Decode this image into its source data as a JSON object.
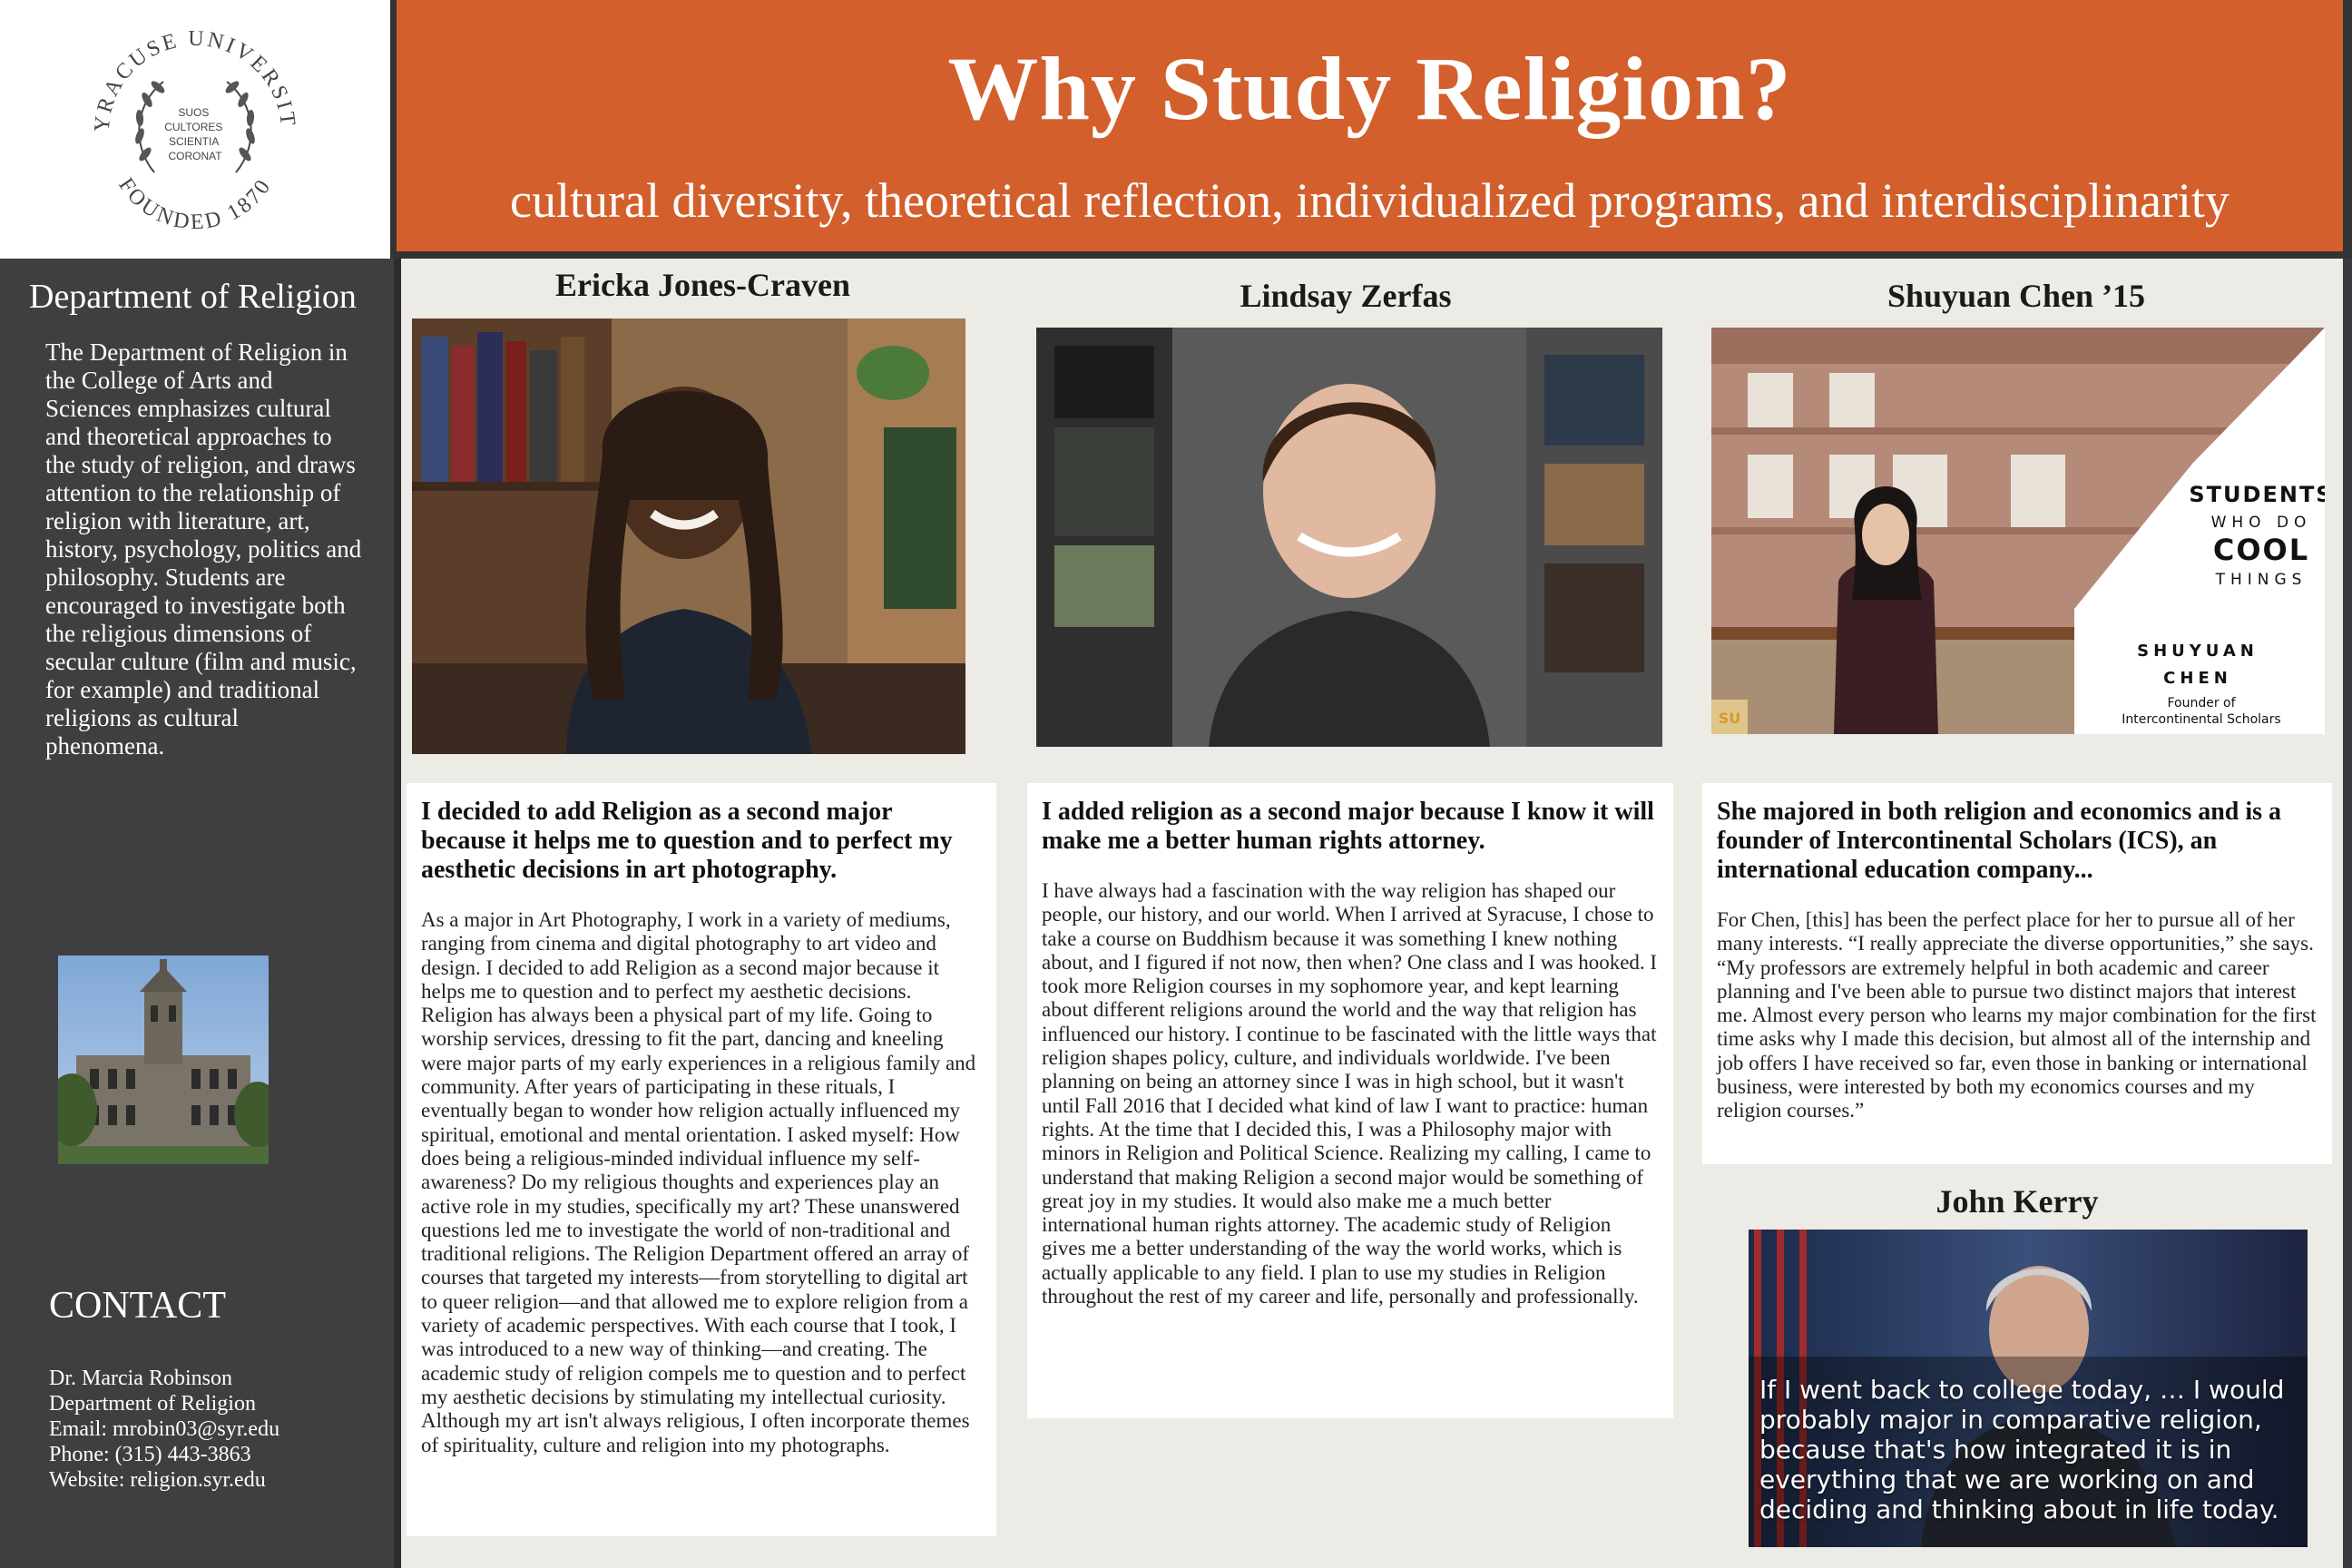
{
  "logo": {
    "ring_text": "SYRACUSE UNIVERSITY",
    "founded_text": "FOUNDED 1870",
    "motto_lines": [
      "SUOS",
      "CULTORES",
      "SCIENTIA",
      "CORONAT"
    ]
  },
  "header": {
    "title": "Why Study Religion?",
    "subtitle": "cultural diversity, theoretical reflection, individualized programs, and interdisciplinarity"
  },
  "sidebar": {
    "heading": "Department of Religion",
    "description": "The Department of Religion in the College of Arts and Sciences emphasizes cultural and theoretical approaches to the study of religion, and draws attention to the relationship of religion with literature, art, history, psychology, politics and philosophy. Students are encouraged to investigate both the religious dimensions of secular culture (film and music, for example) and traditional religions as cultural phenomena.",
    "contact_heading": "CONTACT",
    "contact_lines": [
      "Dr. Marcia Robinson",
      "Department of Religion",
      "Email: mrobin03@syr.edu",
      "Phone: (315) 443-3863",
      "Website: religion.syr.edu"
    ]
  },
  "profiles": [
    {
      "name": "Ericka Jones-Craven",
      "lead": "I decided to add Religion as a second major because it helps me to question and to perfect my aesthetic decisions in art photography.",
      "body": "As a major in Art Photography, I work in a variety of mediums, ranging from cinema and digital photography to art video and design. I decided to add Religion as a second major because it helps me to question and to perfect my aesthetic decisions. Religion has always been a physical part of my life. Going to worship services, dressing to fit the part, dancing and kneeling were major parts of my early experiences in a religious family and community. After years of participating in these rituals, I eventually began to wonder how religion actually influenced my spiritual, emotional and mental orientation. I asked myself: How does being a religious-minded individual influence my self-awareness? Do my religious thoughts and experiences play an active role in my studies, specifically my art? These unanswered questions led me to investigate the world of non-traditional and traditional religions. The Religion Department offered an array of courses that targeted my interests—from storytelling to digital art to queer religion—and that allowed me to explore religion from a variety of academic perspectives. With each course that I took, I was introduced to a new way of thinking—and creating. The academic study of religion compels me to question and to perfect my aesthetic decisions by stimulating my intellectual curiosity. Although my art isn't always religious, I often incorporate themes of spirituality, culture and religion into my photographs."
    },
    {
      "name": "Lindsay Zerfas",
      "lead": "I added religion as a second major because I know it will make me a better human rights attorney.",
      "body": "I have always had a fascination with the way religion has shaped our people, our history, and our world.  When I arrived at Syracuse, I chose to take a course on Buddhism because it was something I knew nothing about, and I figured if not now, then when? One class and I was hooked. I took more Religion courses in my sophomore year, and kept learning about different religions around the world and the way that religion has influenced our history.  I continue to be fascinated with the little ways that religion shapes policy, culture, and individuals worldwide.  I've been planning on being an attorney since I was in high school, but it wasn't until Fall 2016 that I decided what kind of law I want to practice: human rights.  At the time that I decided this, I was a Philosophy major with minors in Religion and Political Science. Realizing my calling, I came to understand that making Religion a second major would be something of great joy in my studies. It would also make me a much better international human rights attorney.  The academic study of Religion gives me a better understanding of the way the world works, which is actually applicable to any field.  I plan to use my studies in Religion throughout the rest of my career and life, personally and professionally."
    },
    {
      "name": "Shuyuan Chen ’15",
      "lead": "She majored in both religion and economics and is a founder of Intercontinental Scholars (ICS), an international education company...",
      "body": "For Chen, [this] has been the perfect place for her to pursue all of her many interests. “I really appreciate the diverse opportunities,” she says. “My professors are extremely helpful in both academic and career planning and I've been able to pursue two distinct majors that interest me. Almost every person who learns my major combination for the first time asks why I made this decision, but almost all of the internship and job offers I have received so far, even those in banking or international business, were interested by both my economics courses and my religion courses.”",
      "badge": {
        "line1": "STUDENTS",
        "line2": "WHO DO",
        "line3": "COOL",
        "line4": "THINGS",
        "name1": "SHUYUAN",
        "name2": "CHEN",
        "role1": "Founder of",
        "role2": "Intercontinental Scholars",
        "corner": "SU"
      }
    }
  ],
  "kerry": {
    "name": "John Kerry",
    "quote": "If I went back to college today, … I would probably major in comparative religion, because that's how integrated it is in everything that we are working on and deciding and thinking about in life today."
  },
  "colors": {
    "banner": "#d35f2c",
    "sidebar": "#3f3f41",
    "background": "#edebe5"
  }
}
